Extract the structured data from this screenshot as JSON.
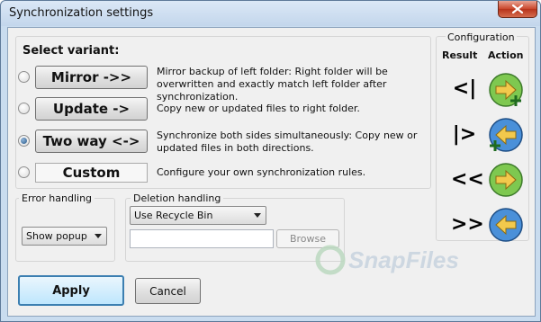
{
  "window": {
    "title": "Synchronization settings"
  },
  "variants": {
    "heading": "Select variant:",
    "items": [
      {
        "label": "Mirror ->>",
        "description": "Mirror backup of left folder: Right folder will be overwritten and exactly match left folder after synchronization.",
        "checked": false
      },
      {
        "label": "Update ->",
        "description": "Copy new or updated files to right folder.",
        "checked": false
      },
      {
        "label": "Two way <->",
        "description": "Synchronize both sides simultaneously: Copy new or updated files in both directions.",
        "checked": true
      },
      {
        "label": "Custom",
        "description": "Configure your own synchronization rules.",
        "checked": false
      }
    ]
  },
  "configuration": {
    "title": "Configuration",
    "result_header": "Result",
    "action_header": "Action",
    "rows": [
      {
        "result": "<|",
        "action_icon": "green-right-arrow-plus-icon"
      },
      {
        "result": "|>",
        "action_icon": "blue-left-arrow-plus-icon"
      },
      {
        "result": "<<",
        "action_icon": "green-right-arrow-icon"
      },
      {
        "result": ">>",
        "action_icon": "blue-left-arrow-icon"
      }
    ]
  },
  "error_handling": {
    "title": "Error handling",
    "selected": "Show popup"
  },
  "deletion_handling": {
    "title": "Deletion handling",
    "selected": "Use Recycle Bin",
    "path_value": "",
    "browse_label": "Browse"
  },
  "buttons": {
    "apply": "Apply",
    "cancel": "Cancel"
  },
  "watermark": "SnapFiles",
  "colors": {
    "green_icon": "#7ec850",
    "blue_icon": "#4a90d9",
    "arrow_yellow": "#f2c94c",
    "accent": "#3c7fb1"
  }
}
